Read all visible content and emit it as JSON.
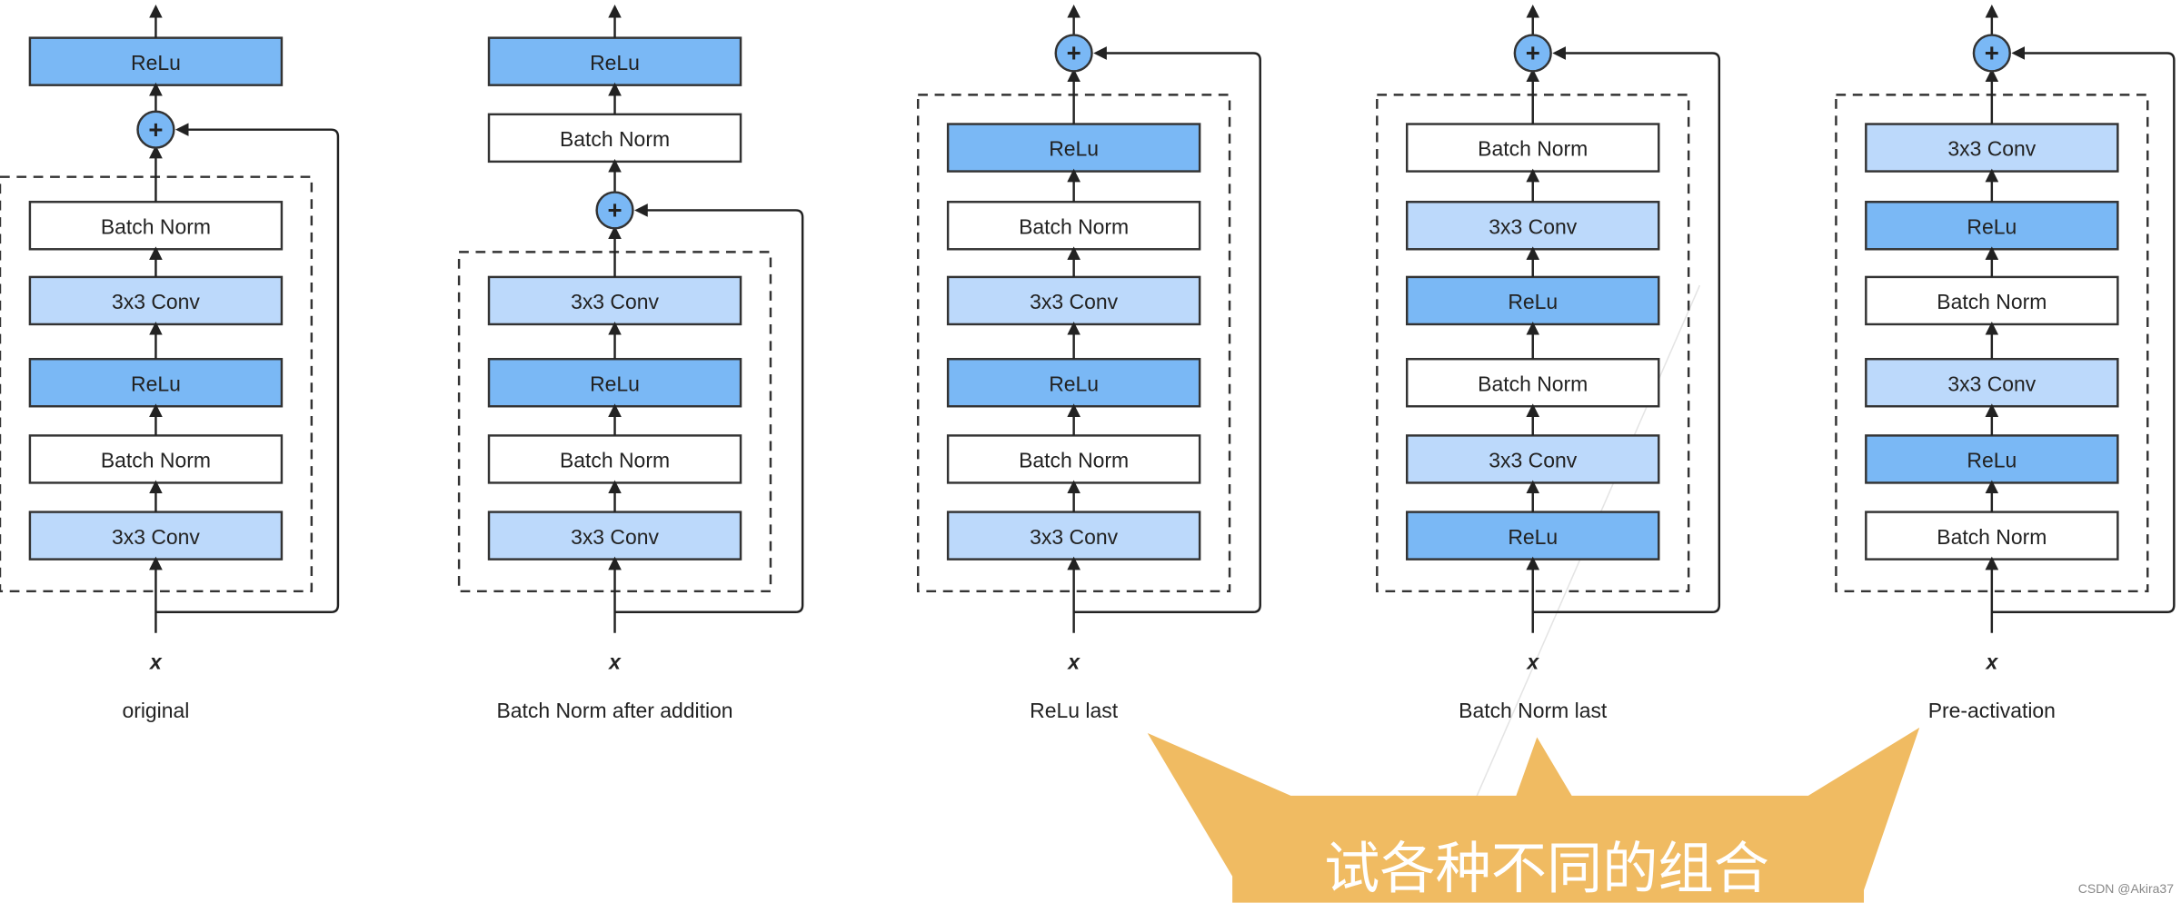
{
  "colors": {
    "relu": "#7ab8f5",
    "conv": "#bcd9fb",
    "batch_norm": "#ffffff",
    "plus": "#7ab8f5",
    "stroke": "#333333",
    "callout": "#f0bb62",
    "callout_text": "#ffffff"
  },
  "block_types": {
    "relu": "ReLu",
    "conv": "3x3 Conv",
    "batch_norm": "Batch Norm"
  },
  "input_label": "x",
  "plus_symbol": "+",
  "variants": [
    {
      "name": "original",
      "after_add": [
        "relu"
      ],
      "before_add": [],
      "residual": [
        "batch_norm",
        "conv",
        "relu",
        "batch_norm",
        "conv"
      ]
    },
    {
      "name": "Batch Norm after addition",
      "after_add": [
        "relu",
        "batch_norm"
      ],
      "before_add": [],
      "residual": [
        "conv",
        "relu",
        "batch_norm",
        "conv"
      ]
    },
    {
      "name": "ReLu last",
      "after_add": [],
      "residual": [
        "relu",
        "batch_norm",
        "conv",
        "relu",
        "batch_norm",
        "conv"
      ]
    },
    {
      "name": "Batch Norm last",
      "after_add": [],
      "residual": [
        "batch_norm",
        "conv",
        "relu",
        "batch_norm",
        "conv",
        "relu"
      ]
    },
    {
      "name": "Pre-activation",
      "after_add": [],
      "residual": [
        "conv",
        "relu",
        "batch_norm",
        "conv",
        "relu",
        "batch_norm"
      ]
    }
  ],
  "callout": {
    "text": "试各种不同的组合"
  },
  "watermark": "CSDN @Akira37"
}
